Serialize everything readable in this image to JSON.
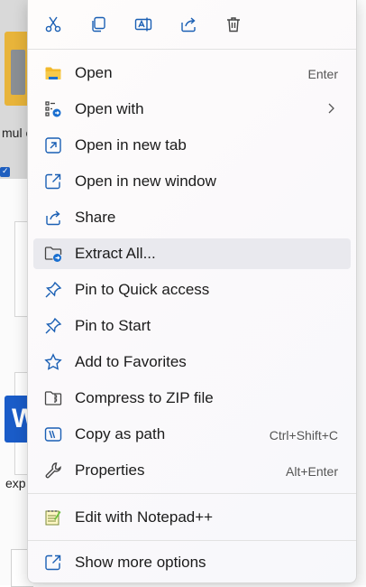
{
  "background": {
    "file_label_1": "mul endal",
    "file_label_2": "exp"
  },
  "toolbar": {
    "buttons": [
      {
        "name": "cut",
        "icon": "scissors-icon"
      },
      {
        "name": "copy",
        "icon": "copy-icon"
      },
      {
        "name": "rename",
        "icon": "rename-icon"
      },
      {
        "name": "share",
        "icon": "share-icon"
      },
      {
        "name": "delete",
        "icon": "trash-icon"
      }
    ]
  },
  "menu": {
    "items": [
      {
        "label": "Open",
        "shortcut": "Enter",
        "icon": "folder-icon"
      },
      {
        "label": "Open with",
        "shortcut": "",
        "icon": "open-with-icon",
        "submenu": true
      },
      {
        "label": "Open in new tab",
        "shortcut": "",
        "icon": "new-tab-icon"
      },
      {
        "label": "Open in new window",
        "shortcut": "",
        "icon": "new-window-icon"
      },
      {
        "label": "Share",
        "shortcut": "",
        "icon": "share-icon"
      },
      {
        "label": "Extract All...",
        "shortcut": "",
        "icon": "extract-icon",
        "highlighted": true
      },
      {
        "label": "Pin to Quick access",
        "shortcut": "",
        "icon": "pin-icon"
      },
      {
        "label": "Pin to Start",
        "shortcut": "",
        "icon": "pin-icon"
      },
      {
        "label": "Add to Favorites",
        "shortcut": "",
        "icon": "star-icon"
      },
      {
        "label": "Compress to ZIP file",
        "shortcut": "",
        "icon": "zip-icon"
      },
      {
        "label": "Copy as path",
        "shortcut": "Ctrl+Shift+C",
        "icon": "copy-path-icon"
      },
      {
        "label": "Properties",
        "shortcut": "Alt+Enter",
        "icon": "wrench-icon"
      },
      {
        "label": "Edit with Notepad++",
        "shortcut": "",
        "icon": "notepadpp-icon"
      },
      {
        "label": "Show more options",
        "shortcut": "",
        "icon": "show-more-icon"
      }
    ]
  },
  "colors": {
    "accent": "#1a6fd0",
    "folder": "#f2b92b",
    "highlight": "#e9e9ee"
  }
}
